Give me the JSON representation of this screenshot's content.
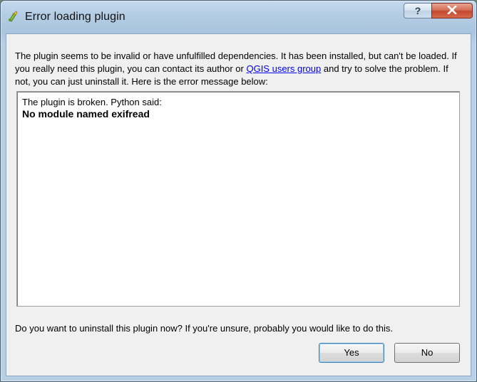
{
  "window": {
    "title": "Error loading plugin",
    "help_label": "?"
  },
  "dialog": {
    "description_before_link": "The plugin seems to be invalid or have unfulfilled dependencies. It has been installed, but can't be loaded. If you really need this plugin, you can contact its author or ",
    "link_text": "QGIS users group",
    "description_after_link": " and try to solve the problem. If not, you can just uninstall it. Here is the error message below:",
    "error_line_1": "The plugin is broken. Python said:",
    "error_line_2": "No module named exifread",
    "question": "Do you want to uninstall this plugin now? If you're unsure, probably you would like to do this."
  },
  "buttons": {
    "yes": "Yes",
    "no": "No"
  }
}
